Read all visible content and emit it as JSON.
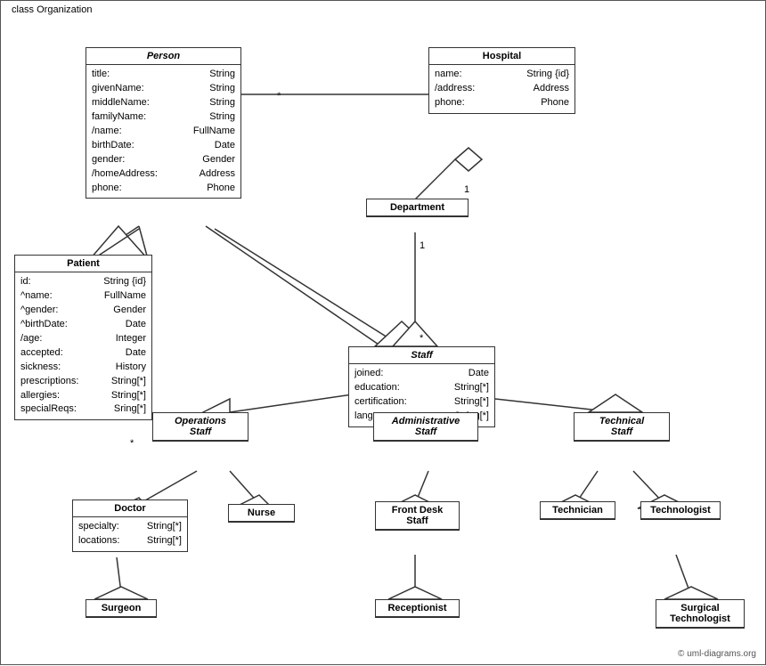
{
  "diagram": {
    "title": "class Organization",
    "classes": {
      "person": {
        "name": "Person",
        "italic": true,
        "attrs": [
          {
            "name": "title:",
            "type": "String"
          },
          {
            "name": "givenName:",
            "type": "String"
          },
          {
            "name": "middleName:",
            "type": "String"
          },
          {
            "name": "familyName:",
            "type": "String"
          },
          {
            "name": "/name:",
            "type": "FullName"
          },
          {
            "name": "birthDate:",
            "type": "Date"
          },
          {
            "name": "gender:",
            "type": "Gender"
          },
          {
            "name": "/homeAddress:",
            "type": "Address"
          },
          {
            "name": "phone:",
            "type": "Phone"
          }
        ]
      },
      "hospital": {
        "name": "Hospital",
        "italic": false,
        "attrs": [
          {
            "name": "name:",
            "type": "String {id}"
          },
          {
            "name": "/address:",
            "type": "Address"
          },
          {
            "name": "phone:",
            "type": "Phone"
          }
        ]
      },
      "patient": {
        "name": "Patient",
        "italic": false,
        "attrs": [
          {
            "name": "id:",
            "type": "String {id}"
          },
          {
            "name": "^name:",
            "type": "FullName"
          },
          {
            "name": "^gender:",
            "type": "Gender"
          },
          {
            "name": "^birthDate:",
            "type": "Date"
          },
          {
            "name": "/age:",
            "type": "Integer"
          },
          {
            "name": "accepted:",
            "type": "Date"
          },
          {
            "name": "sickness:",
            "type": "History"
          },
          {
            "name": "prescriptions:",
            "type": "String[*]"
          },
          {
            "name": "allergies:",
            "type": "String[*]"
          },
          {
            "name": "specialReqs:",
            "type": "Sring[*]"
          }
        ]
      },
      "department": {
        "name": "Department",
        "italic": false,
        "attrs": []
      },
      "staff": {
        "name": "Staff",
        "italic": true,
        "attrs": [
          {
            "name": "joined:",
            "type": "Date"
          },
          {
            "name": "education:",
            "type": "String[*]"
          },
          {
            "name": "certification:",
            "type": "String[*]"
          },
          {
            "name": "languages:",
            "type": "String[*]"
          }
        ]
      },
      "operations_staff": {
        "name": "Operations Staff",
        "italic": true
      },
      "administrative_staff": {
        "name": "Administrative Staff",
        "italic": true
      },
      "technical_staff": {
        "name": "Technical Staff",
        "italic": true
      },
      "doctor": {
        "name": "Doctor",
        "italic": false,
        "attrs": [
          {
            "name": "specialty:",
            "type": "String[*]"
          },
          {
            "name": "locations:",
            "type": "String[*]"
          }
        ]
      },
      "nurse": {
        "name": "Nurse",
        "italic": false,
        "attrs": []
      },
      "front_desk_staff": {
        "name": "Front Desk Staff",
        "italic": false,
        "attrs": []
      },
      "technician": {
        "name": "Technician",
        "italic": false,
        "attrs": []
      },
      "technologist": {
        "name": "Technologist",
        "italic": false,
        "attrs": []
      },
      "surgeon": {
        "name": "Surgeon",
        "italic": false,
        "attrs": []
      },
      "receptionist": {
        "name": "Receptionist",
        "italic": false,
        "attrs": []
      },
      "surgical_technologist": {
        "name": "Surgical Technologist",
        "italic": false,
        "attrs": []
      }
    },
    "copyright": "© uml-diagrams.org"
  }
}
